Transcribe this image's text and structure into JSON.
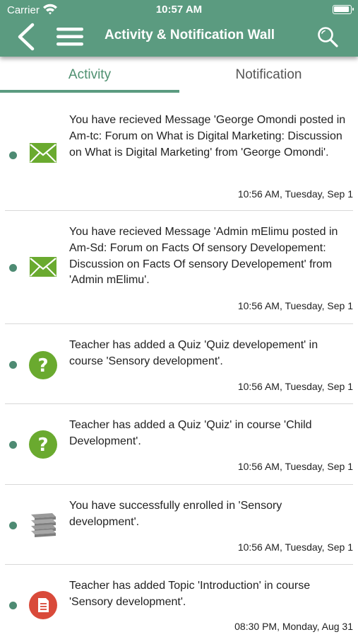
{
  "status_bar": {
    "carrier": "Carrier",
    "time": "10:57 AM"
  },
  "nav": {
    "title": "Activity & Notification Wall",
    "back_icon": "chevron-left-icon",
    "menu_icon": "hamburger-menu-icon",
    "search_icon": "search-icon"
  },
  "tabs": [
    {
      "label": "Activity",
      "active": true
    },
    {
      "label": "Notification",
      "active": false
    }
  ],
  "colors": {
    "header": "#5b9b80",
    "accent": "#4e9070",
    "unread_dot": "#4e8b73",
    "quiz_icon": "#6aaa2f",
    "topic_icon": "#d94a3a"
  },
  "feed": [
    {
      "icon": "envelope-icon",
      "text": "You have recieved Message 'George Omondi posted in Am-tc: Forum on What is Digital Marketing: Discussion on What is Digital Marketing' from 'George Omondi'.",
      "time": "10:56 AM, Tuesday, Sep 1"
    },
    {
      "icon": "envelope-icon",
      "text": "You have recieved Message 'Admin mElimu posted in Am-Sd: Forum on Facts Of sensory Developement: Discussion on Facts Of sensory Developement' from 'Admin mElimu'.",
      "time": "10:56 AM, Tuesday, Sep 1"
    },
    {
      "icon": "question-icon",
      "text": "Teacher has added a Quiz 'Quiz developement' in course 'Sensory development'.",
      "time": "10:56 AM, Tuesday, Sep 1"
    },
    {
      "icon": "question-icon",
      "text": "Teacher has added a Quiz 'Quiz' in course 'Child Development'.",
      "time": "10:56 AM, Tuesday, Sep 1"
    },
    {
      "icon": "books-icon",
      "text": "You have successfully enrolled in 'Sensory development'.",
      "time": "10:56 AM, Tuesday, Sep 1"
    },
    {
      "icon": "document-icon",
      "text": "Teacher has added Topic 'Introduction' in course 'Sensory development'.",
      "time": "08:30 PM, Monday, Aug 31"
    }
  ]
}
